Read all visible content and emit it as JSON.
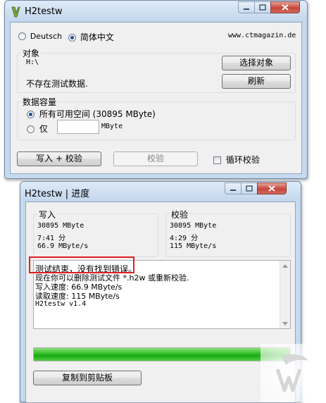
{
  "main_window": {
    "title": "H2testw",
    "language_options": [
      {
        "label": "Deutsch",
        "selected": false
      },
      {
        "label": "简体中文",
        "selected": true
      }
    ],
    "website": "www.ctmagazin.de",
    "target_group": {
      "label": "对象",
      "path": "H:\\",
      "status": "不存在测试数据.",
      "select_button": "选择对象",
      "refresh_button": "刷新"
    },
    "capacity_group": {
      "label": "数据容量",
      "all_space_label": "所有可用空间 (30895 MByte)",
      "only_label": "仅",
      "only_value": "",
      "unit": "MByte"
    },
    "write_verify_button": "写入 + 校验",
    "verify_button": "校验",
    "loop_verify_label": "循环校验"
  },
  "progress_window": {
    "title": "H2testw | 进度",
    "write": {
      "label": "写入",
      "size": "30895 MByte",
      "time": "7:41 分",
      "speed": "66.9 MByte/s"
    },
    "verify": {
      "label": "校验",
      "size": "30895 MByte",
      "time": "4:29 分",
      "speed": "115 MByte/s"
    },
    "log_lines": [
      "测试结束，没有找到错误。",
      "现在你可以删除测试文件 *.h2w 或重新校验.",
      "写入速度: 66.9 MByte/s",
      "读取速度: 115 MByte/s",
      "H2testw v1.4"
    ],
    "progress_fraction": 1.0,
    "copy_button": "复制到剪贴板"
  },
  "colors": {
    "highlight_border": "#e0201f",
    "progress_green": "#1aa814",
    "close_button_red": "#c7453a"
  }
}
